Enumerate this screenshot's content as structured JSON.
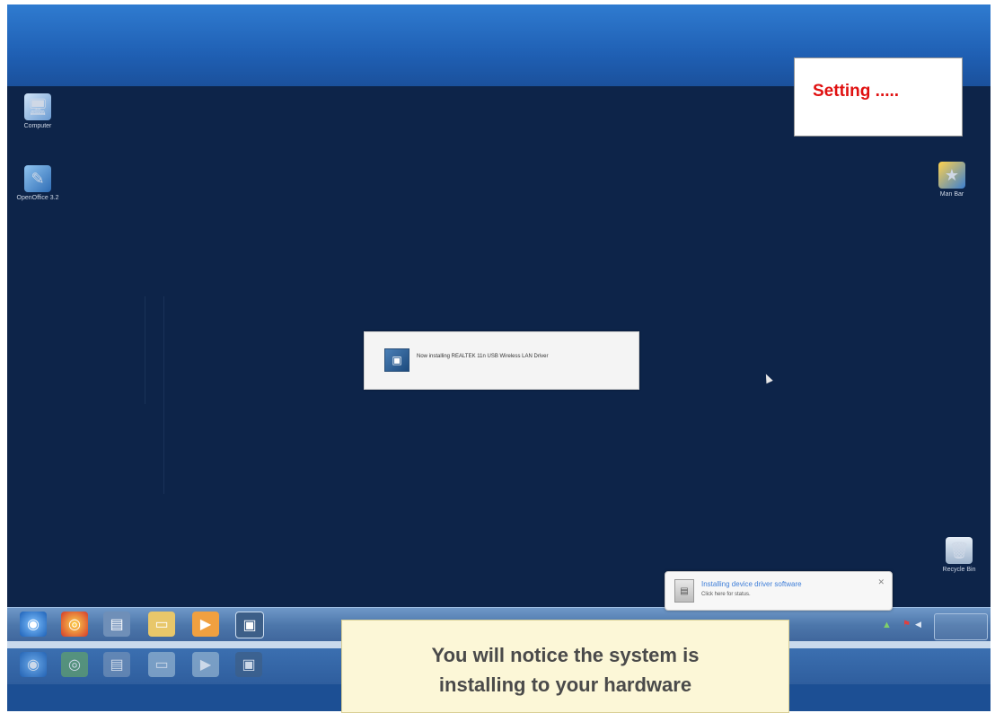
{
  "overlay": {
    "setting_text": "Setting .....",
    "caption_line1": "You will notice the system is",
    "caption_line2": "installing to your hardware"
  },
  "desktop": {
    "icons": [
      {
        "label": "Computer",
        "icon": "computer-icon"
      },
      {
        "label": "OpenOffice 3.2",
        "icon": "openoffice-icon"
      },
      {
        "label": "Man Bar",
        "icon": "shortcut-icon"
      },
      {
        "label": "Recycle Bin",
        "icon": "recycle-bin-icon"
      }
    ]
  },
  "install_dialog": {
    "text": "Now installing REALTEK 11n USB Wireless LAN Driver"
  },
  "driver_popup": {
    "title": "Installing device driver software",
    "subtitle": "Click here for status."
  },
  "taskbar": {
    "buttons": [
      {
        "icon": "start-orb-icon"
      },
      {
        "icon": "chrome-icon"
      },
      {
        "icon": "documents-icon"
      },
      {
        "icon": "folder-icon"
      },
      {
        "icon": "media-player-icon"
      },
      {
        "icon": "installer-icon"
      }
    ]
  },
  "colors": {
    "desktop": "#0d2449",
    "setting_text": "#e01010",
    "caption_bg": "#fcf7d7",
    "taskbar": "#4d77ab"
  }
}
